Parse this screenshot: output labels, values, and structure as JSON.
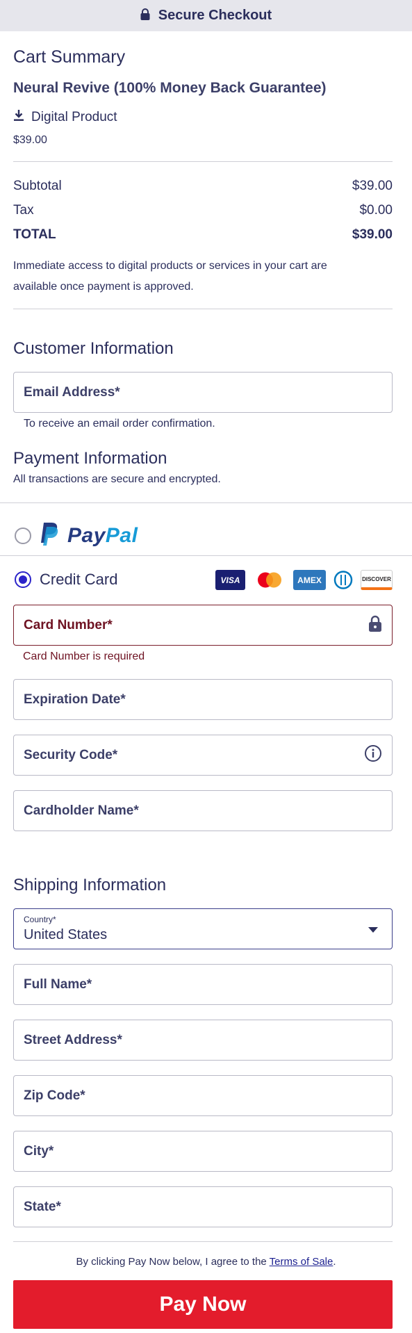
{
  "header": {
    "title": "Secure Checkout",
    "icon": "lock-icon"
  },
  "cart": {
    "heading": "Cart Summary",
    "product_name": "Neural Revive (100% Money Back Guarantee)",
    "product_type": "Digital Product",
    "product_price": "$39.00",
    "subtotal_label": "Subtotal",
    "subtotal_value": "$39.00",
    "tax_label": "Tax",
    "tax_value": "$0.00",
    "total_label": "TOTAL",
    "total_value": "$39.00",
    "note_line1": "Immediate access to digital products or services in your cart are",
    "note_line2": "available once payment is approved."
  },
  "customer": {
    "heading": "Customer Information",
    "email_label": "Email Address*",
    "email_hint": "To receive an email order confirmation."
  },
  "payment": {
    "heading": "Payment Information",
    "subheading": "All transactions are secure and encrypted.",
    "paypal_label_1": "Pay",
    "paypal_label_2": "Pal",
    "credit_card_label": "Credit Card",
    "card_brands": [
      "VISA",
      "Mastercard",
      "AMEX",
      "Diners",
      "DISCOVER"
    ],
    "card_number_label": "Card Number*",
    "card_number_error": "Card Number is required",
    "expiration_label": "Expiration Date*",
    "security_code_label": "Security Code*",
    "cardholder_label": "Cardholder Name*"
  },
  "shipping": {
    "heading": "Shipping Information",
    "country_label": "Country*",
    "country_value": "United States",
    "full_name_label": "Full Name*",
    "street_label": "Street Address*",
    "zip_label": "Zip Code*",
    "city_label": "City*",
    "state_label": "State*"
  },
  "footer": {
    "agree_text": "By clicking Pay Now below, I agree to the ",
    "terms_link": "Terms of Sale",
    "agree_end": ".",
    "pay_button": "Pay Now"
  },
  "colors": {
    "accent": "#2b23c9",
    "pay_button": "#e31c2c",
    "error": "#6e1222",
    "text": "#2b2e5c"
  }
}
